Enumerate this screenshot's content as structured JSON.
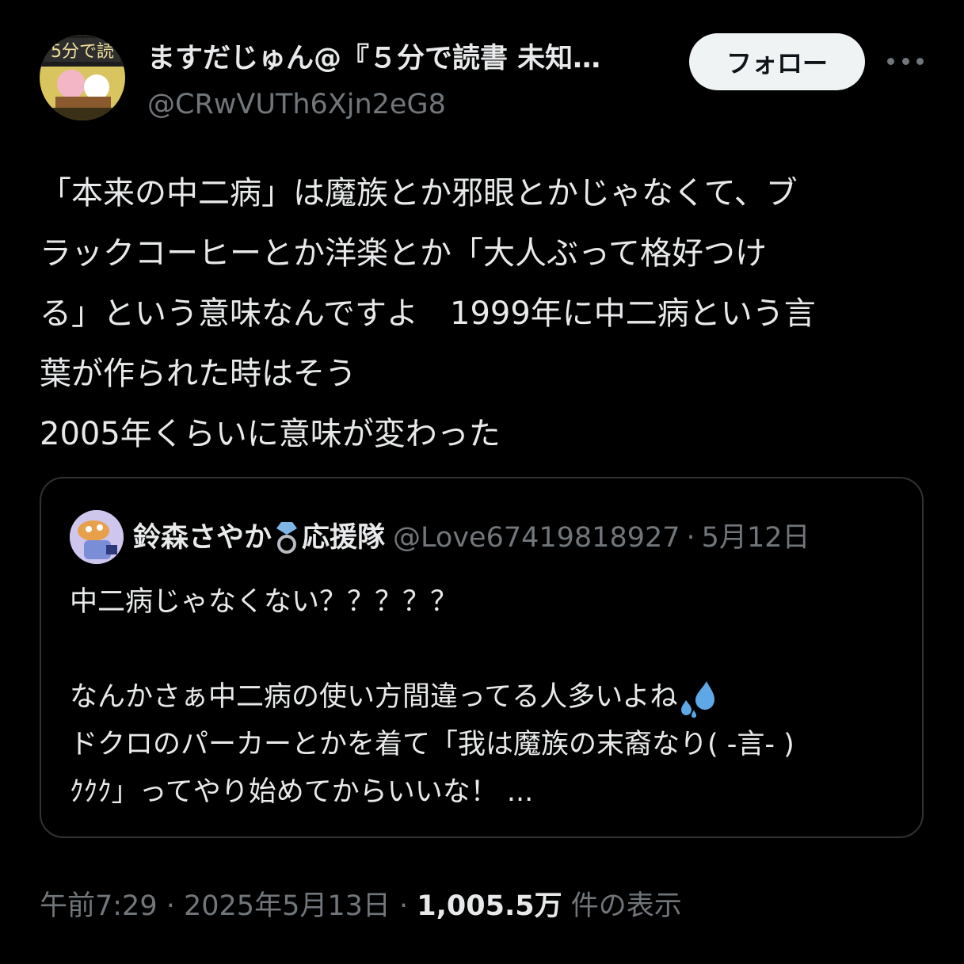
{
  "author": {
    "display_name": "ますだじゅん@『５分で読書 未知…",
    "handle": "@CRwVUTh6Xjn2eG8",
    "avatar_icon": "book-cover-avatar"
  },
  "follow_label": "フォロー",
  "tweet_lines": [
    "「本来の中二病」は魔族とか邪眼とかじゃなくて、ブ",
    "ラックコーヒーとか洋楽とか「大人ぶって格好つけ",
    "る」という意味なんですよ　1999年に中二病という言",
    "葉が作られた時はそう",
    "2005年くらいに意味が変わった"
  ],
  "quote": {
    "name": "鈴森さやか",
    "name_suffix": "応援隊",
    "ring_icon": "ring-emoji",
    "handle": "@Love67419818927",
    "separator": "·",
    "date": "5月12日",
    "lines": [
      "中二病じゃなくない？？？？？",
      "",
      "なんかさぁ中二病の使い方間違ってる人多いよね",
      "ドクロのパーカーとかを着て「我は魔族の末裔なり( -言- )",
      "ｸｸｸ」ってやり始めてからいいな！ ..."
    ],
    "sweat_icon": "sweat-drops-emoji"
  },
  "meta": {
    "time": "午前7:29",
    "sep1": " · ",
    "date": "2025年5月13日",
    "sep2": " · ",
    "views_count": "1,005.5万",
    "views_label": " 件の表示"
  },
  "colors": {
    "background": "#000000",
    "text": "#e7e9ea",
    "secondary": "#71767b",
    "border": "#2f3336",
    "follow_bg": "#eff3f4"
  }
}
